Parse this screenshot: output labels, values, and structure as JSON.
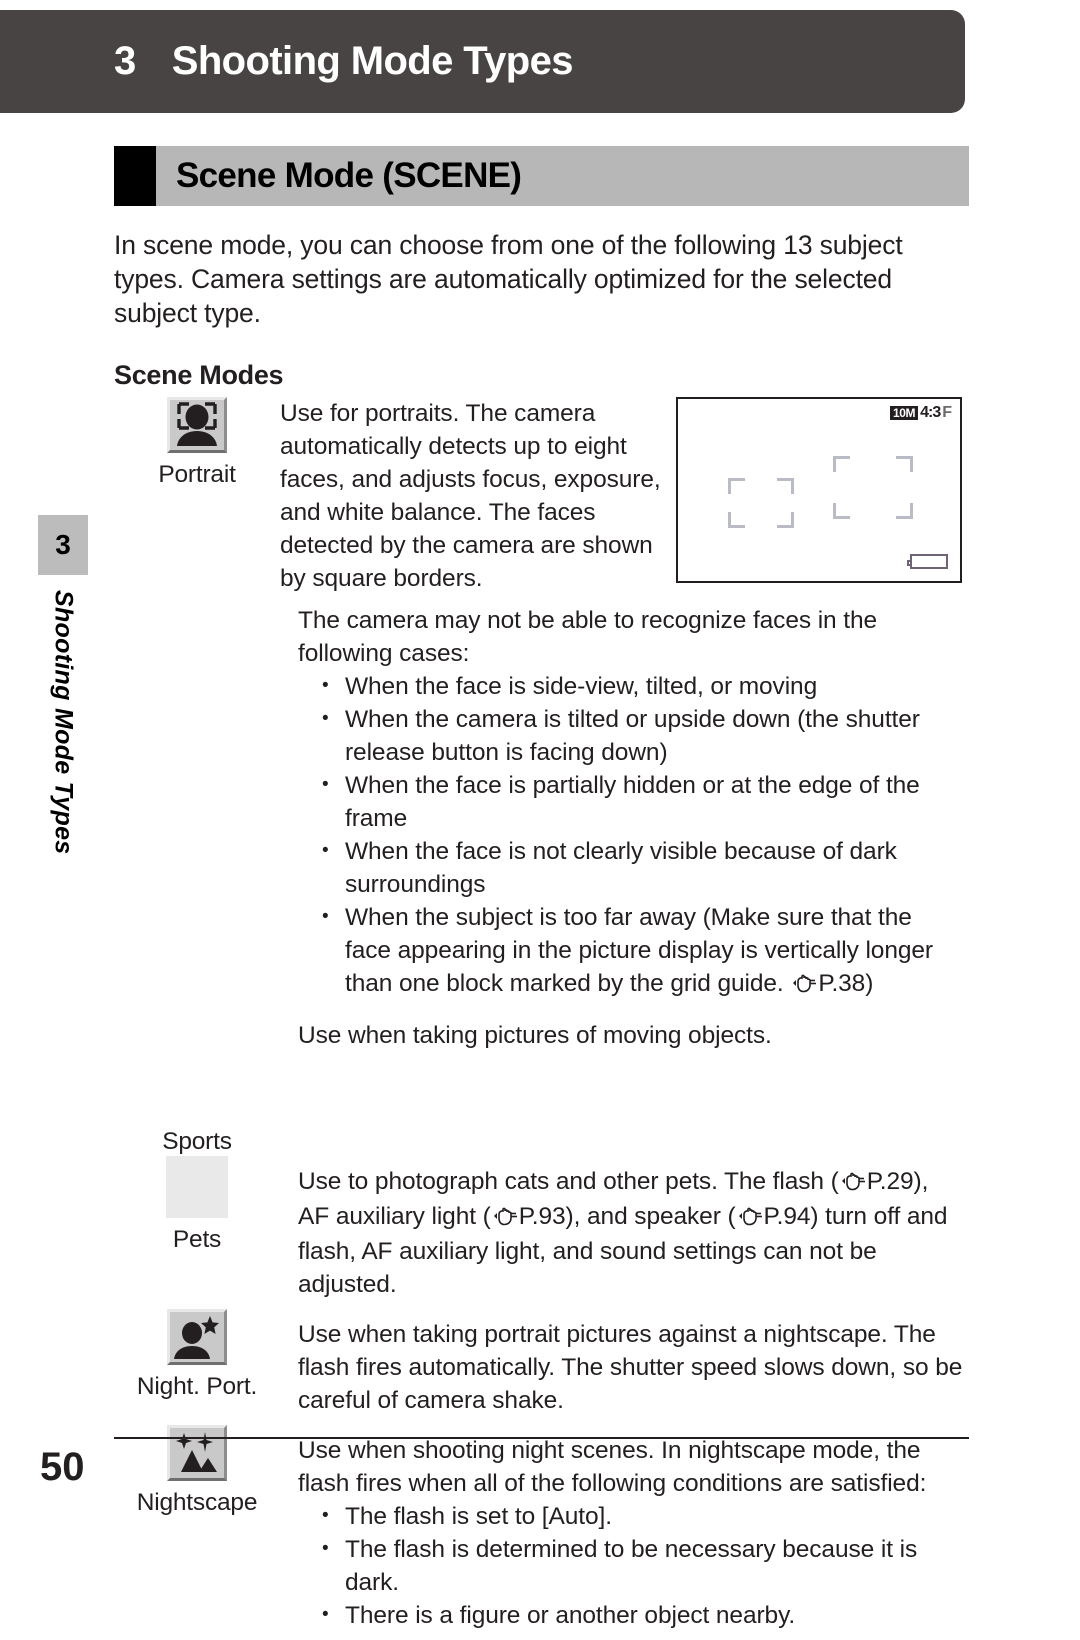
{
  "chapter": {
    "number": "3",
    "title": "Shooting Mode Types",
    "side_number": "3",
    "side_title": "Shooting Mode Types"
  },
  "section": {
    "title": "Scene Mode (SCENE)"
  },
  "intro": "In scene mode, you can choose from one of the following 13 subject types. Camera settings are automatically optimized for the selected subject type.",
  "subheading": "Scene Modes",
  "camera_display": {
    "badges": {
      "resolution": "10M",
      "aspect": "4:3",
      "quality": "F"
    },
    "icon_names": {
      "battery": "battery-icon",
      "face_frame": "face-detection-frame"
    }
  },
  "table": {
    "rows": [
      {
        "label": "Portrait",
        "icon": "portrait-face-detect-icon",
        "description": "Use for portraits. The camera automatically detects up to eight faces, and adjusts focus, exposure, and white balance. The faces detected by the camera are shown by square borders."
      },
      {
        "label": "Sports",
        "icon": "sports-icon-missing",
        "description": "Use when taking pictures of moving objects."
      },
      {
        "label": "Pets",
        "icon": "pets-icon-placeholder",
        "description_parts": {
          "p1": "Use to photograph cats and other pets. The flash (",
          "ref1": "P.29",
          "p2": "), AF auxiliary light (",
          "ref2": "P.93",
          "p3": "), and speaker (",
          "ref3": "P.94",
          "p4": ") turn off and flash, AF auxiliary light, and sound settings can not be adjusted."
        }
      },
      {
        "label": "Night. Port.",
        "icon": "night-portrait-icon",
        "description": "Use when taking portrait pictures against a nightscape. The flash fires automatically. The shutter speed slows down, so be careful of camera shake."
      },
      {
        "label": "Nightscape",
        "icon": "nightscape-icon",
        "description": "Use when shooting night scenes. In nightscape mode, the flash fires when all of the following conditions are satisfied:",
        "bullets": [
          "The flash is set to [Auto].",
          "The flash is determined to be necessary because it is dark.",
          "There is a figure or another object nearby."
        ]
      }
    ]
  },
  "face_note": {
    "intro": "The camera may not be able to recognize faces in the following cases:",
    "bullets": [
      "When the face is side-view, tilted, or moving",
      "When the camera is tilted or upside down (the shutter release button is facing down)",
      "When the face is partially hidden or at the edge of the frame",
      "When the face is not clearly visible because of dark surroundings"
    ],
    "last_bullet": {
      "text": "When the subject is too far away (Make sure that the face appearing in the picture display is vertically longer than one block marked by the grid guide. ",
      "ref": "P.38",
      "tail": ")"
    }
  },
  "footer": {
    "page_number": "50"
  },
  "colors": {
    "header_bar": "#474443",
    "section_bar": "#b7b7b7",
    "section_tab": "#000000",
    "text": "#231f20",
    "side_tab": "#bcbcbc"
  }
}
